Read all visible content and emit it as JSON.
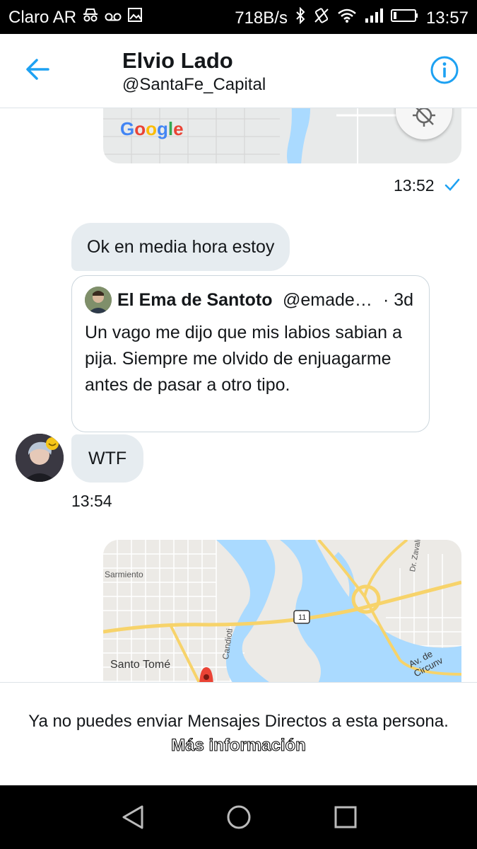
{
  "status_bar": {
    "carrier": "Claro AR",
    "speed": "718B/s",
    "time": "13:57"
  },
  "header": {
    "name": "Elvio Lado",
    "handle": "@SantaFe_Capital",
    "back_icon": "arrow-left-icon",
    "info_icon": "info-icon"
  },
  "messages": {
    "map_top": {
      "logo": "Google",
      "time": "13:52",
      "status": "sent"
    },
    "bubble_text": "Ok en media hora estoy",
    "quoted_tweet": {
      "name": "El Ema de Santoto",
      "handle": "@emade…",
      "time": "· 3d",
      "text": "Un vago me dijo que mis labios sabian a pija. Siempre me olvido de enjuagarme antes de pasar a otro tipo."
    },
    "reply_text": "WTF",
    "reply_time": "13:54",
    "map_bottom": {
      "labels": [
        "Sarmiento",
        "11",
        "Santo Tomé",
        "Candioti",
        "Dr. Zavalla",
        "Av. de Circunv"
      ]
    }
  },
  "footer": {
    "text": "Ya no puedes enviar Mensajes Directos a esta persona.",
    "link": "Más información"
  },
  "colors": {
    "accent": "#1da1f2",
    "bubble": "#e6ecf0",
    "map_water": "#aadaff",
    "map_road": "#f7d36a"
  }
}
